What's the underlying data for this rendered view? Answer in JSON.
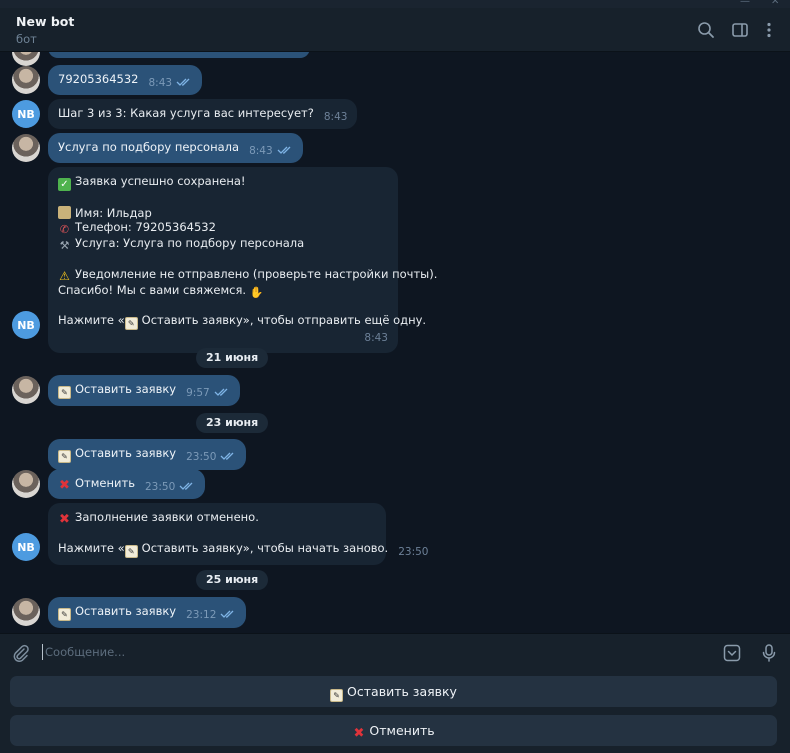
{
  "window": {
    "minimize": "—",
    "close": "✕"
  },
  "header": {
    "title": "New bot",
    "subtitle": "бот"
  },
  "icons": {
    "search": "search-icon",
    "sidebar": "sidebar-toggle-icon",
    "menu": "more-vertical-icon",
    "attach": "paperclip-icon",
    "keyboard": "keyboard-icon",
    "mic": "microphone-icon"
  },
  "bot_avatar": "NB",
  "messages": {
    "m1": {
      "text": "79205364532",
      "time": "8:43"
    },
    "m2": {
      "text": "Шаг 3 из 3: Какая услуга вас интересует?",
      "time": "8:43"
    },
    "m3": {
      "text": "Услуга по подбору персонала",
      "time": "8:43"
    },
    "m4": {
      "l1": "Заявка успешно сохранена!",
      "l2": "Имя: Ильдар",
      "l3": "Телефон: 79205364532",
      "l4": "Услуга: Услуга по подбору персонала",
      "l5": "Уведомление не отправлено (проверьте настройки почты).",
      "l6": "Спасибо! Мы с вами свяжемся.",
      "l7a": "Нажмите «",
      "l7b": "Оставить заявку», чтобы отправить ещё одну.",
      "time": "8:43"
    },
    "m5": {
      "text": "Оставить заявку",
      "time": "9:57"
    },
    "m6": {
      "text": "Оставить заявку",
      "time": "23:50"
    },
    "m7": {
      "text": "Отменить",
      "time": "23:50"
    },
    "m8": {
      "l1": "Заполнение заявки отменено.",
      "l2a": "Нажмите «",
      "l2b": "Оставить заявку», чтобы начать заново.",
      "time": "23:50"
    },
    "m9": {
      "text": "Оставить заявку",
      "time": "23:12"
    }
  },
  "dates": {
    "d1": "21 июня",
    "d2": "23 июня",
    "d3": "25 июня"
  },
  "input": {
    "placeholder": "Сообщение..."
  },
  "keyboard": {
    "b1": "Оставить заявку",
    "b2": "Отменить"
  },
  "colors": {
    "accent": "#4d9be0",
    "outgoing": "#2b5278",
    "incoming": "#182533",
    "background": "#0e1621"
  }
}
